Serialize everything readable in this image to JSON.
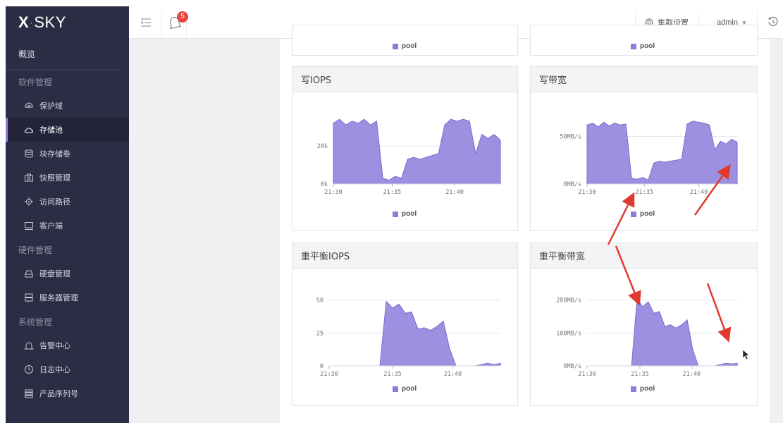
{
  "app": {
    "logo": "X·SKY",
    "logo_x": "X",
    "logo_rest": "SKY"
  },
  "sidebar": {
    "overview": "概览",
    "sections": [
      {
        "title": "软件管理",
        "items": [
          {
            "label": "保护域",
            "icon": "protection-domain-icon"
          },
          {
            "label": "存储池",
            "icon": "cloud-pool-icon",
            "active": true
          },
          {
            "label": "块存储卷",
            "icon": "database-icon"
          },
          {
            "label": "快照管理",
            "icon": "camera-icon"
          },
          {
            "label": "访问路径",
            "icon": "target-icon"
          },
          {
            "label": "客户端",
            "icon": "monitor-icon"
          }
        ]
      },
      {
        "title": "硬件管理",
        "items": [
          {
            "label": "硬盘管理",
            "icon": "disk-icon"
          },
          {
            "label": "服务器管理",
            "icon": "server-icon"
          }
        ]
      },
      {
        "title": "系统管理",
        "items": [
          {
            "label": "告警中心",
            "icon": "bell-icon"
          },
          {
            "label": "日志中心",
            "icon": "clock-icon"
          },
          {
            "label": "产品序列号",
            "icon": "serial-icon"
          }
        ]
      }
    ]
  },
  "topbar": {
    "notification_count": "5",
    "cluster_settings": "集群设置",
    "user": "admin"
  },
  "colors": {
    "series": "#8b7ddb",
    "sidebar_bg": "#2b2d44",
    "badge": "#e8453c",
    "arrow": "#e03a2f"
  },
  "legend_label": "pool",
  "cards": {
    "top_left_legend": "pool",
    "top_right_legend": "pool",
    "write_iops_title": "写IOPS",
    "write_bw_title": "写带宽",
    "rebalance_iops_title": "重平衡IOPS",
    "rebalance_bw_title": "重平衡带宽"
  },
  "chart_data": [
    {
      "type": "area",
      "title": "写IOPS",
      "x_ticks": [
        "21:30",
        "21:35",
        "21:40"
      ],
      "y_ticks": [
        "0k",
        "20k"
      ],
      "x": [
        "21:30",
        "21:30:30",
        "21:31",
        "21:31:30",
        "21:32",
        "21:32:30",
        "21:33",
        "21:33:30",
        "21:34",
        "21:34:30",
        "21:35",
        "21:35:30",
        "21:36",
        "21:36:30",
        "21:37",
        "21:37:30",
        "21:38",
        "21:38:30",
        "21:39",
        "21:39:30",
        "21:40",
        "21:40:30",
        "21:41",
        "21:41:30",
        "21:42",
        "21:42:30",
        "21:43",
        "21:43:30"
      ],
      "series": [
        {
          "name": "pool",
          "values": [
            32,
            34,
            31,
            33,
            32,
            34,
            31,
            33,
            3,
            2,
            4,
            3,
            13,
            14,
            13,
            14,
            15,
            16,
            31,
            34,
            33,
            34,
            33,
            16,
            26,
            24,
            26,
            23
          ]
        }
      ],
      "ylim": [
        0,
        40
      ]
    },
    {
      "type": "area",
      "title": "写带宽",
      "x_ticks": [
        "21:30",
        "21:35",
        "21:40"
      ],
      "y_ticks": [
        "0MB/s",
        "50MB/s"
      ],
      "x": [
        "21:30",
        "21:30:30",
        "21:31",
        "21:31:30",
        "21:32",
        "21:32:30",
        "21:33",
        "21:33:30",
        "21:34",
        "21:34:30",
        "21:35",
        "21:35:30",
        "21:36",
        "21:36:30",
        "21:37",
        "21:37:30",
        "21:38",
        "21:38:30",
        "21:39",
        "21:39:30",
        "21:40",
        "21:40:30",
        "21:41",
        "21:41:30",
        "21:42",
        "21:42:30",
        "21:43",
        "21:43:30"
      ],
      "series": [
        {
          "name": "pool",
          "values": [
            62,
            64,
            60,
            65,
            61,
            64,
            62,
            63,
            6,
            5,
            7,
            4,
            22,
            24,
            23,
            24,
            25,
            26,
            63,
            66,
            65,
            64,
            62,
            36,
            45,
            42,
            47,
            44
          ]
        }
      ],
      "ylim": [
        0,
        80
      ]
    },
    {
      "type": "area",
      "title": "重平衡IOPS",
      "x_ticks": [
        "21:30",
        "21:35",
        "21:40"
      ],
      "y_ticks": [
        "0",
        "25",
        "50"
      ],
      "x": [
        "21:30",
        "21:30:30",
        "21:31",
        "21:31:30",
        "21:32",
        "21:32:30",
        "21:33",
        "21:33:30",
        "21:34",
        "21:34:30",
        "21:35",
        "21:35:30",
        "21:36",
        "21:36:30",
        "21:37",
        "21:37:30",
        "21:38",
        "21:38:30",
        "21:39",
        "21:39:30",
        "21:40",
        "21:40:30",
        "21:41",
        "21:41:30",
        "21:42",
        "21:42:30",
        "21:43",
        "21:43:30"
      ],
      "series": [
        {
          "name": "pool",
          "values": [
            0,
            0,
            0,
            0,
            0,
            0,
            0,
            0,
            0,
            49,
            44,
            47,
            40,
            41,
            28,
            29,
            27,
            30,
            34,
            13,
            0,
            0,
            0,
            0,
            1,
            2,
            1,
            2
          ]
        }
      ],
      "ylim": [
        0,
        60
      ]
    },
    {
      "type": "area",
      "title": "重平衡带宽",
      "x_ticks": [
        "21:30",
        "21:35",
        "21:40"
      ],
      "y_ticks": [
        "0MB/s",
        "100MB/s",
        "200MB/s"
      ],
      "x": [
        "21:30",
        "21:30:30",
        "21:31",
        "21:31:30",
        "21:32",
        "21:32:30",
        "21:33",
        "21:33:30",
        "21:34",
        "21:34:30",
        "21:35",
        "21:35:30",
        "21:36",
        "21:36:30",
        "21:37",
        "21:37:30",
        "21:38",
        "21:38:30",
        "21:39",
        "21:39:30",
        "21:40",
        "21:40:30",
        "21:41",
        "21:41:30",
        "21:42",
        "21:42:30",
        "21:43",
        "21:43:30"
      ],
      "series": [
        {
          "name": "pool",
          "values": [
            0,
            0,
            0,
            0,
            0,
            0,
            0,
            0,
            0,
            205,
            180,
            195,
            160,
            165,
            120,
            125,
            115,
            125,
            140,
            50,
            0,
            0,
            0,
            0,
            4,
            8,
            6,
            8
          ]
        }
      ],
      "ylim": [
        0,
        240
      ]
    }
  ]
}
